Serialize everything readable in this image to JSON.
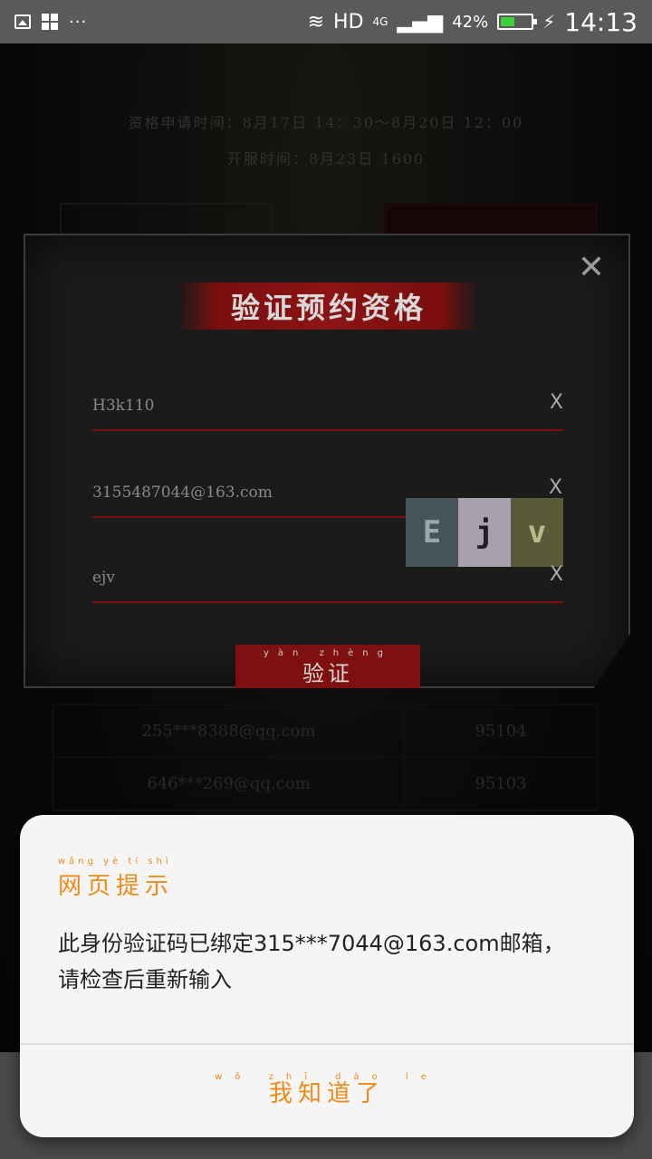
{
  "status_bar": {
    "network": "HD",
    "signal_type": "4G",
    "battery_percent": "42%",
    "battery_level": 0.42,
    "time": "14:13"
  },
  "background_page": {
    "apply_time": "资格申请时间：8月17日 14：30～8月20日 12：00",
    "open_time": "开服时间：8月23日 1600",
    "table_rows": [
      {
        "email": "255***8388@qq.com",
        "number": "95104"
      },
      {
        "email": "646***269@qq.com",
        "number": "95103"
      }
    ]
  },
  "modal": {
    "title": "验证预约资格",
    "fields": [
      {
        "value": "H3k110",
        "clear": "X"
      },
      {
        "value": "3155487044@163.com",
        "clear": "X"
      },
      {
        "value": "ejv",
        "clear": "X"
      }
    ],
    "captcha": [
      "E",
      "j",
      "v"
    ],
    "verify_button": "验证",
    "verify_pinyin": "yàn zhèng"
  },
  "dialog": {
    "title": "网页提示",
    "title_pinyin": "wǎng yè tí shì",
    "message": "此身份验证码已绑定315***7044@163.com邮箱，请检查后重新输入",
    "ok_button": "我知道了",
    "ok_pinyin": "wǒ zhī dào le"
  }
}
